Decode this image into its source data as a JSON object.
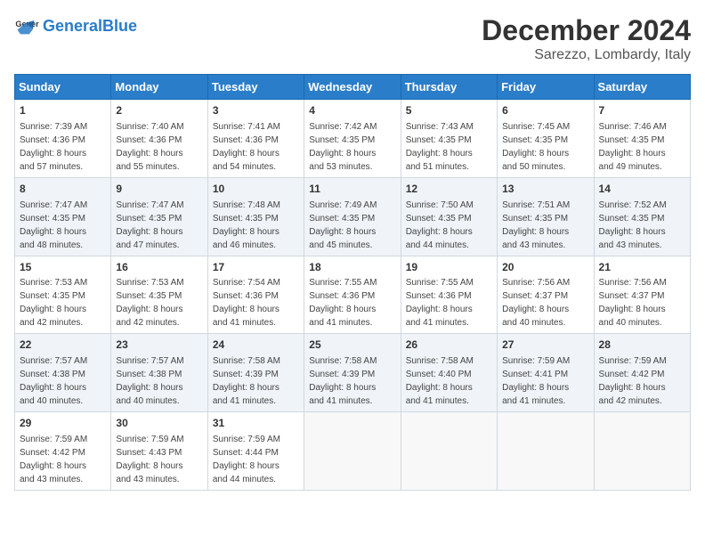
{
  "logo": {
    "text_general": "General",
    "text_blue": "Blue"
  },
  "title": "December 2024",
  "subtitle": "Sarezzo, Lombardy, Italy",
  "weekdays": [
    "Sunday",
    "Monday",
    "Tuesday",
    "Wednesday",
    "Thursday",
    "Friday",
    "Saturday"
  ],
  "weeks": [
    [
      {
        "day": "1",
        "sunrise": "7:39 AM",
        "sunset": "4:36 PM",
        "daylight": "8 hours and 57 minutes."
      },
      {
        "day": "2",
        "sunrise": "7:40 AM",
        "sunset": "4:36 PM",
        "daylight": "8 hours and 55 minutes."
      },
      {
        "day": "3",
        "sunrise": "7:41 AM",
        "sunset": "4:36 PM",
        "daylight": "8 hours and 54 minutes."
      },
      {
        "day": "4",
        "sunrise": "7:42 AM",
        "sunset": "4:35 PM",
        "daylight": "8 hours and 53 minutes."
      },
      {
        "day": "5",
        "sunrise": "7:43 AM",
        "sunset": "4:35 PM",
        "daylight": "8 hours and 51 minutes."
      },
      {
        "day": "6",
        "sunrise": "7:45 AM",
        "sunset": "4:35 PM",
        "daylight": "8 hours and 50 minutes."
      },
      {
        "day": "7",
        "sunrise": "7:46 AM",
        "sunset": "4:35 PM",
        "daylight": "8 hours and 49 minutes."
      }
    ],
    [
      {
        "day": "8",
        "sunrise": "7:47 AM",
        "sunset": "4:35 PM",
        "daylight": "8 hours and 48 minutes."
      },
      {
        "day": "9",
        "sunrise": "7:47 AM",
        "sunset": "4:35 PM",
        "daylight": "8 hours and 47 minutes."
      },
      {
        "day": "10",
        "sunrise": "7:48 AM",
        "sunset": "4:35 PM",
        "daylight": "8 hours and 46 minutes."
      },
      {
        "day": "11",
        "sunrise": "7:49 AM",
        "sunset": "4:35 PM",
        "daylight": "8 hours and 45 minutes."
      },
      {
        "day": "12",
        "sunrise": "7:50 AM",
        "sunset": "4:35 PM",
        "daylight": "8 hours and 44 minutes."
      },
      {
        "day": "13",
        "sunrise": "7:51 AM",
        "sunset": "4:35 PM",
        "daylight": "8 hours and 43 minutes."
      },
      {
        "day": "14",
        "sunrise": "7:52 AM",
        "sunset": "4:35 PM",
        "daylight": "8 hours and 43 minutes."
      }
    ],
    [
      {
        "day": "15",
        "sunrise": "7:53 AM",
        "sunset": "4:35 PM",
        "daylight": "8 hours and 42 minutes."
      },
      {
        "day": "16",
        "sunrise": "7:53 AM",
        "sunset": "4:35 PM",
        "daylight": "8 hours and 42 minutes."
      },
      {
        "day": "17",
        "sunrise": "7:54 AM",
        "sunset": "4:36 PM",
        "daylight": "8 hours and 41 minutes."
      },
      {
        "day": "18",
        "sunrise": "7:55 AM",
        "sunset": "4:36 PM",
        "daylight": "8 hours and 41 minutes."
      },
      {
        "day": "19",
        "sunrise": "7:55 AM",
        "sunset": "4:36 PM",
        "daylight": "8 hours and 41 minutes."
      },
      {
        "day": "20",
        "sunrise": "7:56 AM",
        "sunset": "4:37 PM",
        "daylight": "8 hours and 40 minutes."
      },
      {
        "day": "21",
        "sunrise": "7:56 AM",
        "sunset": "4:37 PM",
        "daylight": "8 hours and 40 minutes."
      }
    ],
    [
      {
        "day": "22",
        "sunrise": "7:57 AM",
        "sunset": "4:38 PM",
        "daylight": "8 hours and 40 minutes."
      },
      {
        "day": "23",
        "sunrise": "7:57 AM",
        "sunset": "4:38 PM",
        "daylight": "8 hours and 40 minutes."
      },
      {
        "day": "24",
        "sunrise": "7:58 AM",
        "sunset": "4:39 PM",
        "daylight": "8 hours and 41 minutes."
      },
      {
        "day": "25",
        "sunrise": "7:58 AM",
        "sunset": "4:39 PM",
        "daylight": "8 hours and 41 minutes."
      },
      {
        "day": "26",
        "sunrise": "7:58 AM",
        "sunset": "4:40 PM",
        "daylight": "8 hours and 41 minutes."
      },
      {
        "day": "27",
        "sunrise": "7:59 AM",
        "sunset": "4:41 PM",
        "daylight": "8 hours and 41 minutes."
      },
      {
        "day": "28",
        "sunrise": "7:59 AM",
        "sunset": "4:42 PM",
        "daylight": "8 hours and 42 minutes."
      }
    ],
    [
      {
        "day": "29",
        "sunrise": "7:59 AM",
        "sunset": "4:42 PM",
        "daylight": "8 hours and 43 minutes."
      },
      {
        "day": "30",
        "sunrise": "7:59 AM",
        "sunset": "4:43 PM",
        "daylight": "8 hours and 43 minutes."
      },
      {
        "day": "31",
        "sunrise": "7:59 AM",
        "sunset": "4:44 PM",
        "daylight": "8 hours and 44 minutes."
      },
      null,
      null,
      null,
      null
    ]
  ]
}
